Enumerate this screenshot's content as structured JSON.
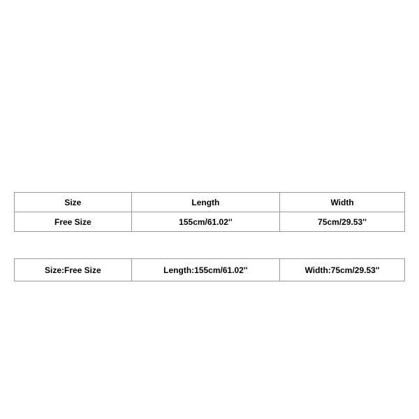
{
  "table1": {
    "headers": {
      "size": "Size",
      "length": "Length",
      "width": "Width"
    },
    "row": {
      "size": "Free Size",
      "length": "155cm/61.02''",
      "width": "75cm/29.53''"
    }
  },
  "table2": {
    "size": "Size:Free Size",
    "length": "Length:155cm/61.02''",
    "width": "Width:75cm/29.53''"
  }
}
